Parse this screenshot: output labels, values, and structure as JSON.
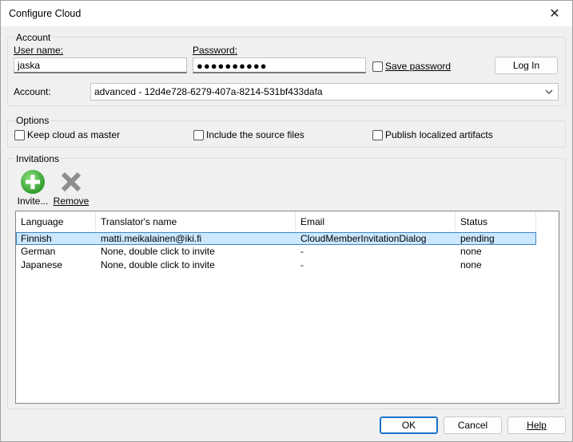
{
  "window": {
    "title": "Configure Cloud",
    "close_symbol": "✕"
  },
  "account": {
    "group_label": "Account",
    "username_label": "User name:",
    "username_value": "jaska",
    "password_label": "Password:",
    "password_value": "●●●●●●●●●●",
    "save_password_label": "Save password",
    "login_label": "Log In",
    "account_label": "Account:",
    "account_value": "advanced - 12d4e728-6279-407a-8214-531bf433dafa"
  },
  "options": {
    "group_label": "Options",
    "keep_master": "Keep cloud as master",
    "include_source": "Include the source files",
    "publish_localized": "Publish localized artifacts"
  },
  "invitations": {
    "group_label": "Invitations",
    "invite_label": "Invite...",
    "remove_label": "Remove",
    "columns": [
      "Language",
      "Translator's name",
      "Email",
      "Status"
    ],
    "rows": [
      {
        "language": "Finnish",
        "name": "matti.meikalainen@iki.fi",
        "email": "CloudMemberInvitationDialog",
        "status": "pending"
      },
      {
        "language": "German",
        "name": "None, double click to invite",
        "email": "-",
        "status": "none"
      },
      {
        "language": "Japanese",
        "name": "None, double click to invite",
        "email": "-",
        "status": "none"
      }
    ]
  },
  "footer": {
    "ok": "OK",
    "cancel": "Cancel",
    "help": "Help"
  },
  "colors": {
    "invite_icon": "#3aa935",
    "remove_icon": "#8e8e8e",
    "selection": "#cce8ff",
    "default_button_border": "#1a73c9"
  }
}
